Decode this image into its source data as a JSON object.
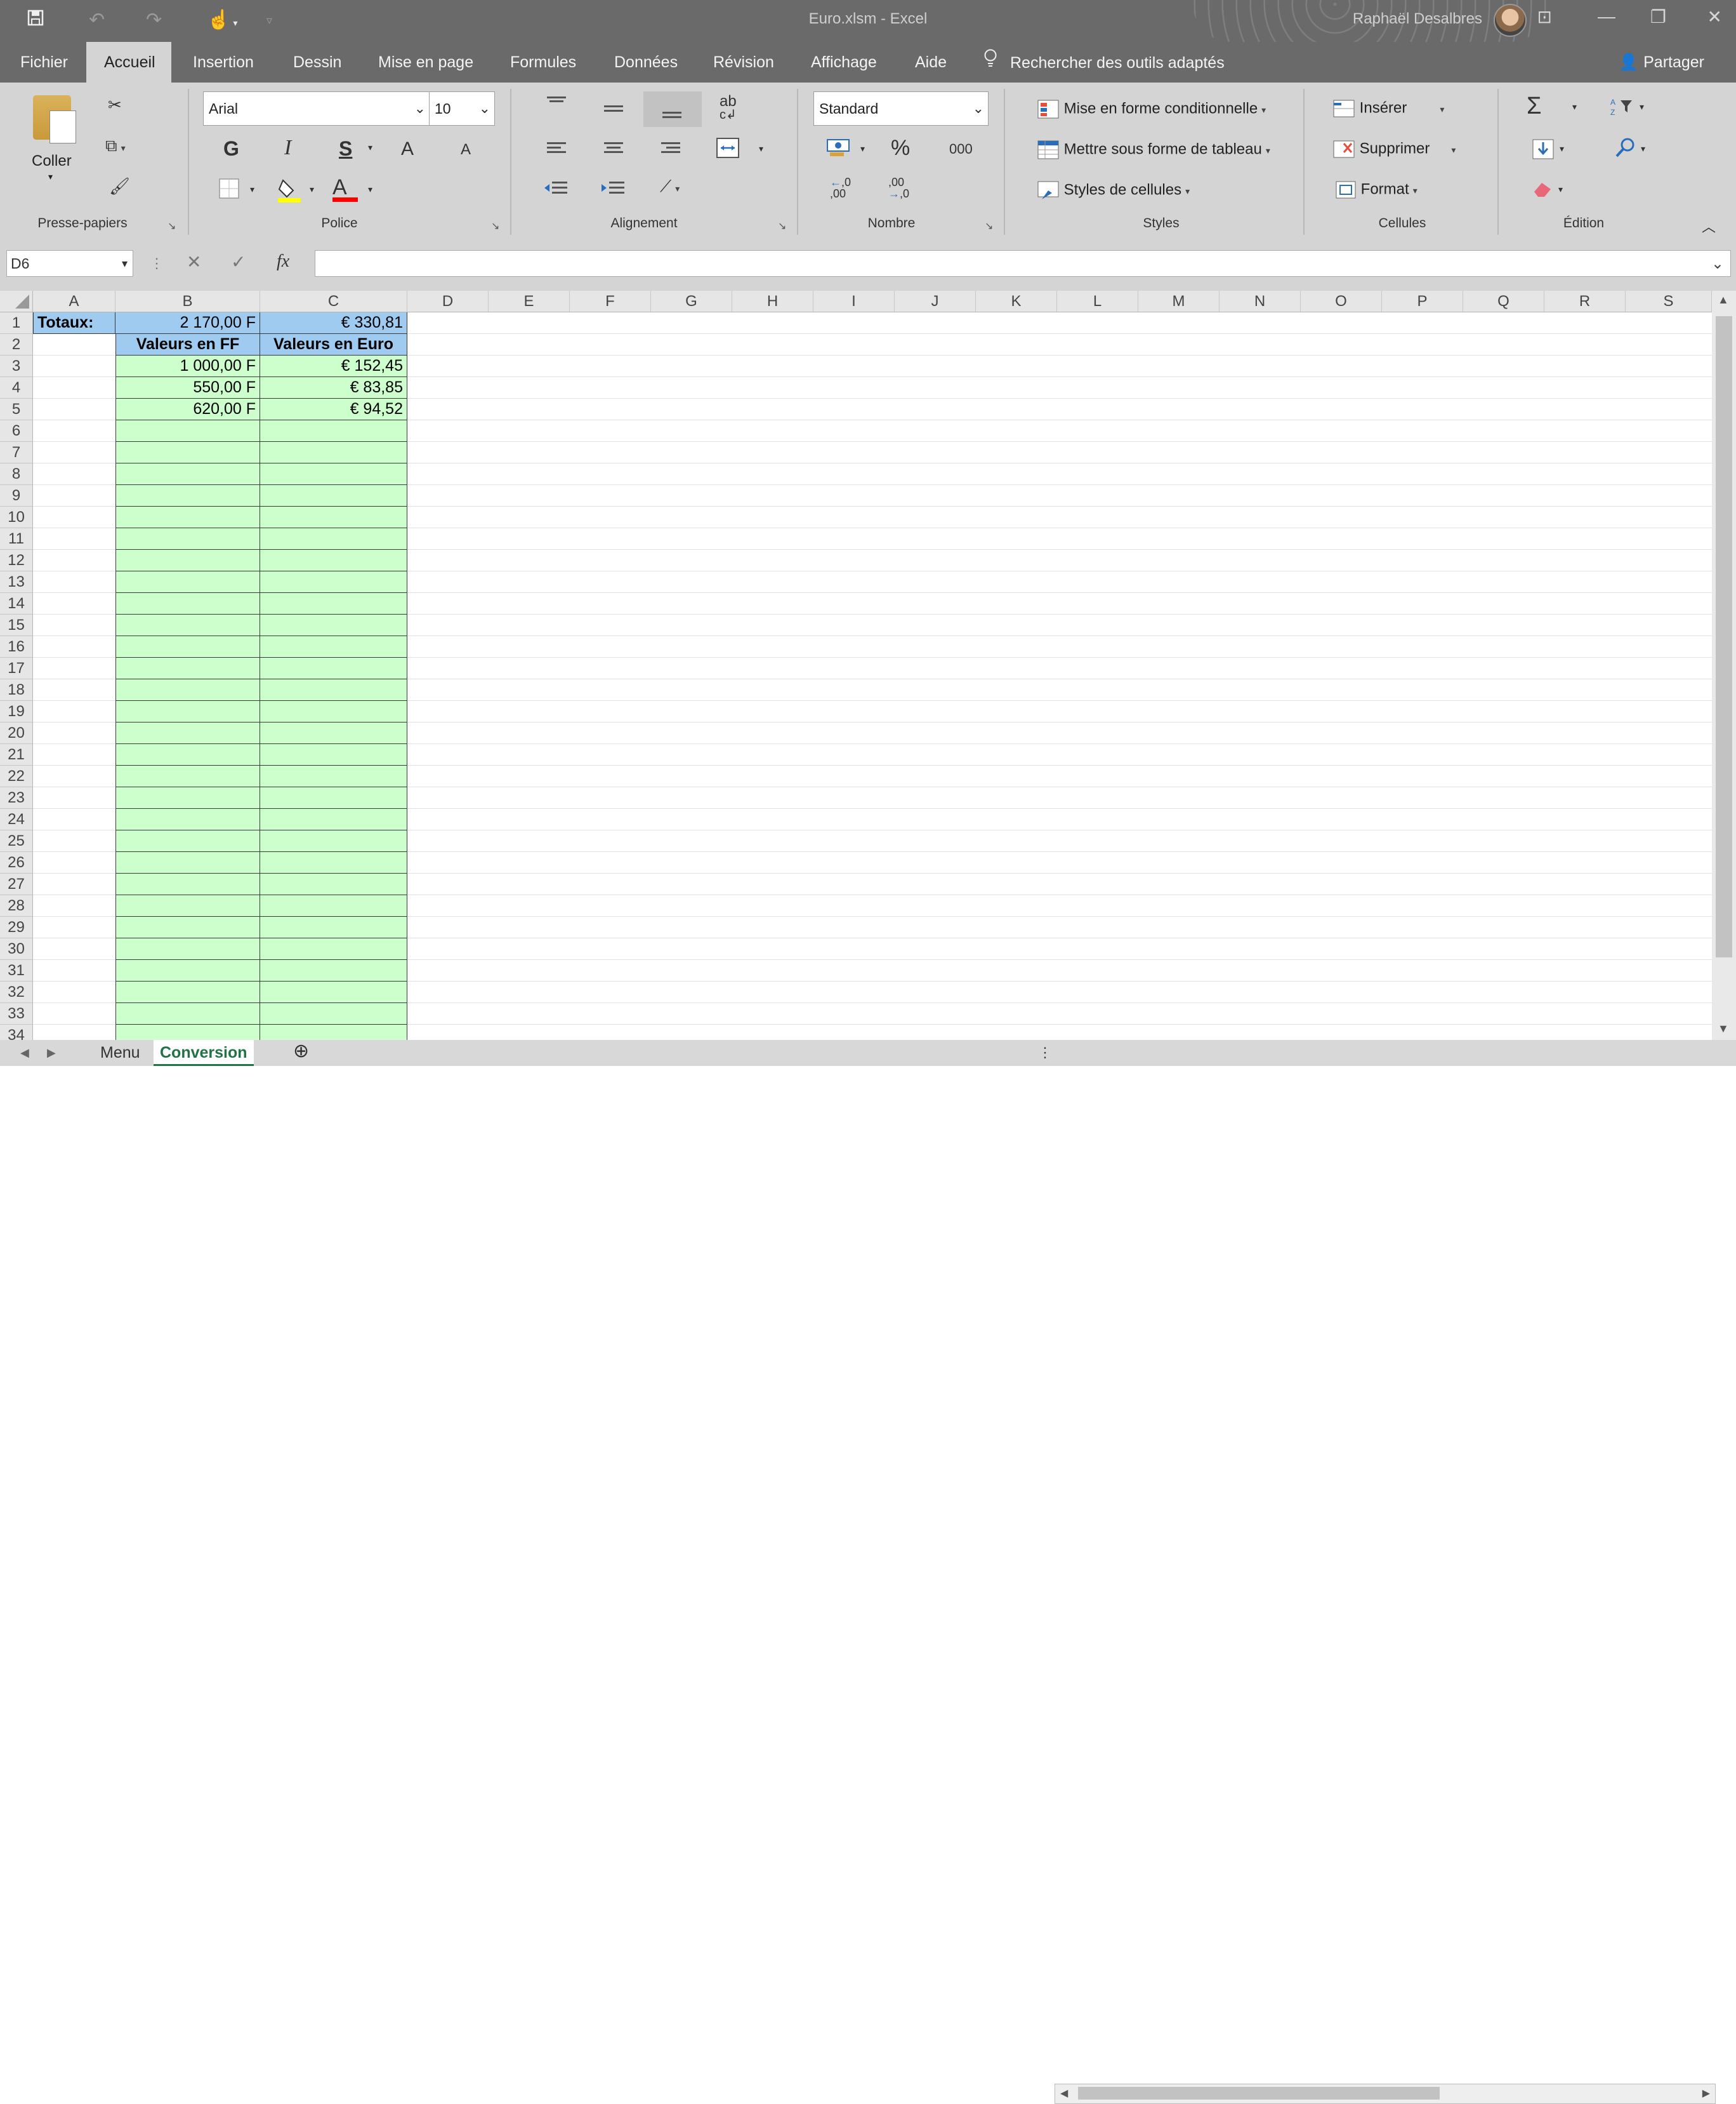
{
  "window": {
    "title": "Euro.xlsm  -  Excel",
    "user": "Raphaël Desalbres",
    "controls": [
      "ribbon-display-icon",
      "minimize-icon",
      "restore-icon",
      "close-icon"
    ]
  },
  "quick_access": [
    "save-icon",
    "undo-icon",
    "redo-icon",
    "touch-mode-icon",
    "customize-icon"
  ],
  "tabs": [
    "Fichier",
    "Accueil",
    "Insertion",
    "Dessin",
    "Mise en page",
    "Formules",
    "Données",
    "Révision",
    "Affichage",
    "Aide"
  ],
  "active_tab": "Accueil",
  "tell_me": "Rechercher des outils adaptés",
  "share": "Partager",
  "ribbon": {
    "clipboard": {
      "paste": "Coller",
      "label": "Presse-papiers"
    },
    "font": {
      "name": "Arial",
      "size": "10",
      "bold": "G",
      "italic": "I",
      "underline": "S",
      "grow": "A",
      "shrink": "A",
      "color": "A",
      "label": "Police"
    },
    "alignment": {
      "wrap": "ab",
      "label": "Alignement"
    },
    "number": {
      "format": "Standard",
      "percent": "%",
      "thousands": "000",
      "inc_decimal": ",00",
      "dec_decimal": ",0",
      "label": "Nombre"
    },
    "styles": {
      "conditional": "Mise en forme conditionnelle",
      "table": "Mettre sous forme de tableau",
      "cell_styles": "Styles de cellules",
      "label": "Styles"
    },
    "cells": {
      "insert": "Insérer",
      "delete": "Supprimer",
      "format": "Format",
      "label": "Cellules"
    },
    "editing": {
      "sum": "Σ",
      "label": "Édition"
    }
  },
  "formula_bar": {
    "name_box": "D6",
    "fx": "fx",
    "value": ""
  },
  "columns": [
    "A",
    "B",
    "C",
    "D",
    "E",
    "F",
    "G",
    "H",
    "I",
    "J",
    "K",
    "L",
    "M",
    "N",
    "O",
    "P",
    "Q",
    "R",
    "S"
  ],
  "rows": [
    "1",
    "2",
    "3",
    "4",
    "5",
    "6",
    "7",
    "8",
    "9",
    "10",
    "11",
    "12",
    "13",
    "14",
    "15",
    "16",
    "17",
    "18",
    "19",
    "20",
    "21",
    "22",
    "23",
    "24",
    "25",
    "26",
    "27",
    "28",
    "29",
    "30",
    "31",
    "32",
    "33",
    "34"
  ],
  "cells": {
    "A1": "Totaux:",
    "B1": "2 170,00 F",
    "C1": "€ 330,81",
    "B2": "Valeurs en FF",
    "C2": "Valeurs en Euro",
    "B3": "1 000,00 F",
    "C3": "€ 152,45",
    "B4": "550,00 F",
    "C4": "€ 83,85",
    "B5": "620,00 F",
    "C5": "€ 94,52"
  },
  "colors": {
    "header_fill": "#9fcbf1",
    "data_fill": "#ccffcc",
    "chrome": "#6a6a6a",
    "ribbon": "#d4d4d4",
    "sheet_accent": "#217346"
  },
  "sheets": [
    "Menu",
    "Conversion"
  ],
  "active_sheet": "Conversion"
}
